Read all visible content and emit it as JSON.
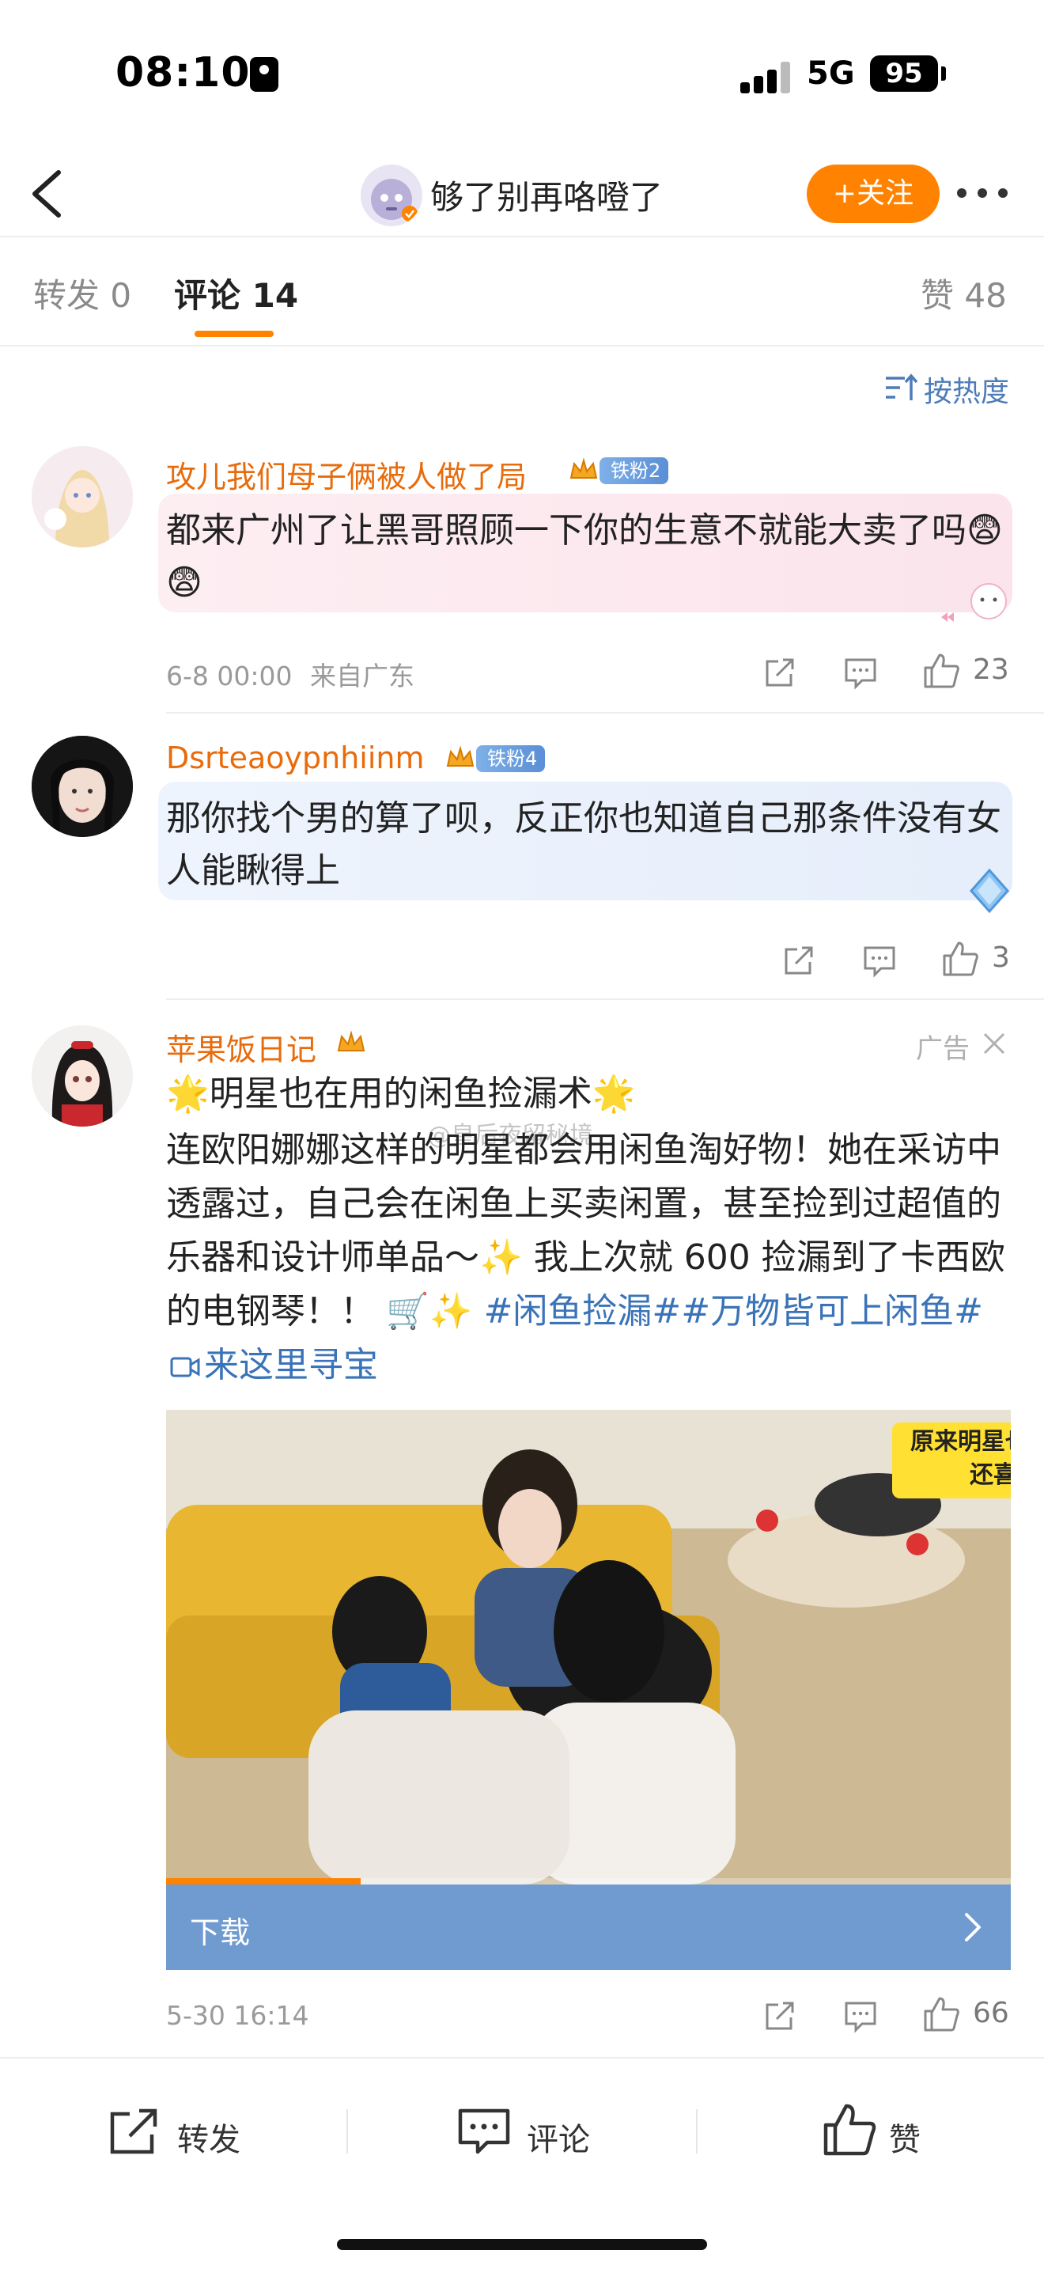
{
  "status_bar": {
    "time": "08:10",
    "network": "5G",
    "battery": "95"
  },
  "header": {
    "title": "够了别再咯噔了",
    "follow_label": "+关注",
    "icons": {
      "back": "chevron-left-icon",
      "more": "more-dots-icon"
    }
  },
  "tabs": {
    "repost": "转发 0",
    "comments": "评论 14",
    "likes": "赞 48"
  },
  "sort": {
    "label": "按热度",
    "icon": "sort-icon"
  },
  "comments": [
    {
      "username": "攻儿我们母子俩被人做了局",
      "fan_badge": "铁粉2",
      "text": "都来广州了让黑哥照顾一下你的生意不就能大卖了吗😨😨",
      "time": "6-8 00:00",
      "location": "来自广东",
      "likes": "23"
    },
    {
      "username": "Dsrteaoypnhiinm",
      "fan_badge": "铁粉4",
      "text": "那你找个男的算了呗，反正你也知道自己那条件没有女人能瞅得上",
      "likes": "3"
    }
  ],
  "ad": {
    "username": "苹果饭日记",
    "ad_label": "广告",
    "title": "🌟明星也在用的闲鱼捡漏术🌟",
    "body_text": "连欧阳娜娜这样的明星都会用闲鱼淘好物！她在采访中透露过，自己会在闲鱼上买卖闲置，甚至捡到过超值的乐器和设计师单品～✨ 我上次就 600 捡漏到了卡西欧的电钢琴！！ 🛒✨",
    "hashtags": "#闲鱼捡漏##万物皆可上闲鱼#",
    "link_text": "来这里寻宝",
    "watermark": "@皇后夜留秘境",
    "image_caption_line1": "原来明星也喜欢用闲鱼",
    "image_caption_line2": "还喜欢砍价",
    "video_progress": 0.23,
    "download_label": "下载",
    "time": "5-30 16:14",
    "likes": "66"
  },
  "bottom_bar": {
    "repost": "转发",
    "comment": "评论",
    "like": "赞"
  },
  "colors": {
    "accent_orange": "#ff8200",
    "username_orange": "#e86b0c",
    "link_blue": "#3a73b8",
    "download_blue": "#6f9bd1"
  }
}
